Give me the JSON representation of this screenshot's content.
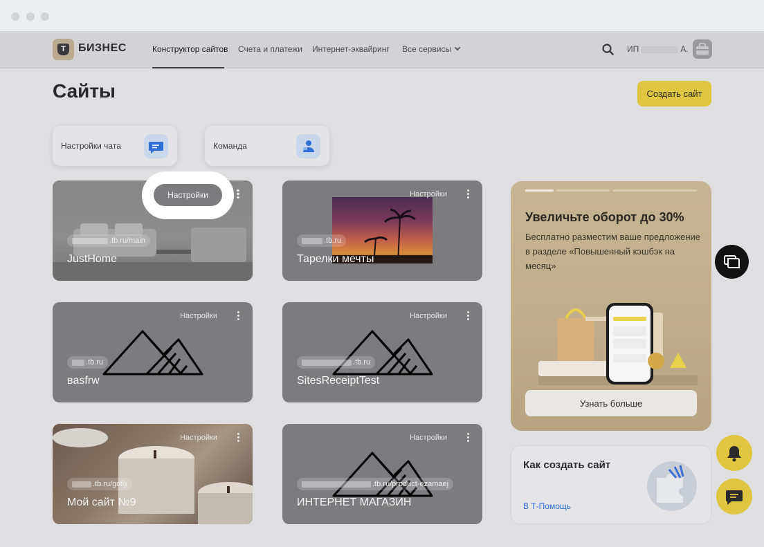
{
  "nav": {
    "logo_letter": "Т",
    "logo_text": "БИЗНЕС",
    "menu": [
      {
        "label": "Конструктор сайтов"
      },
      {
        "label": "Счета и платежи"
      },
      {
        "label": "Интернет-эквайринг"
      },
      {
        "label": "Все сервисы"
      }
    ],
    "user_prefix": "ИП",
    "user_suffix": "А."
  },
  "page": {
    "title": "Сайты",
    "create_button": "Создать сайт"
  },
  "quick_actions": [
    {
      "label": "Настройки чата",
      "icon": "chat-settings-icon"
    },
    {
      "label": "Команда",
      "icon": "team-icon"
    }
  ],
  "sites": [
    {
      "name": "JustHome",
      "url": ".tb.ru/main",
      "settings": "Настройки"
    },
    {
      "name": "Тарелки мечты",
      "url": ".tb.ru",
      "settings": "Настройки"
    },
    {
      "name": "вasfrw",
      "url": ".tb.ru",
      "settings": "Настройки"
    },
    {
      "name": "SitesReceiptTest",
      "url": ".tb.ru",
      "settings": "Настройки"
    },
    {
      "name": "Мой сайт №9",
      "url": ".tb.ru/gdfg",
      "settings": "Настройки"
    },
    {
      "name": "ИНТЕРНЕТ МАГАЗИН",
      "url": ".tb.ru/product-ezamaej",
      "settings": "Настройки"
    }
  ],
  "highlight": {
    "label": "Настройки"
  },
  "promo": {
    "title": "Увеличьте оборот до 30%",
    "description": "Бесплатно разместим ваше предложение в разделе «Повышенный кэшбэк на месяц»",
    "button": "Узнать больше"
  },
  "howto": {
    "title": "Как создать сайт",
    "link": "В Т-Помощь"
  },
  "colors": {
    "accent": "#e0c640",
    "link": "#2c6ed6"
  }
}
